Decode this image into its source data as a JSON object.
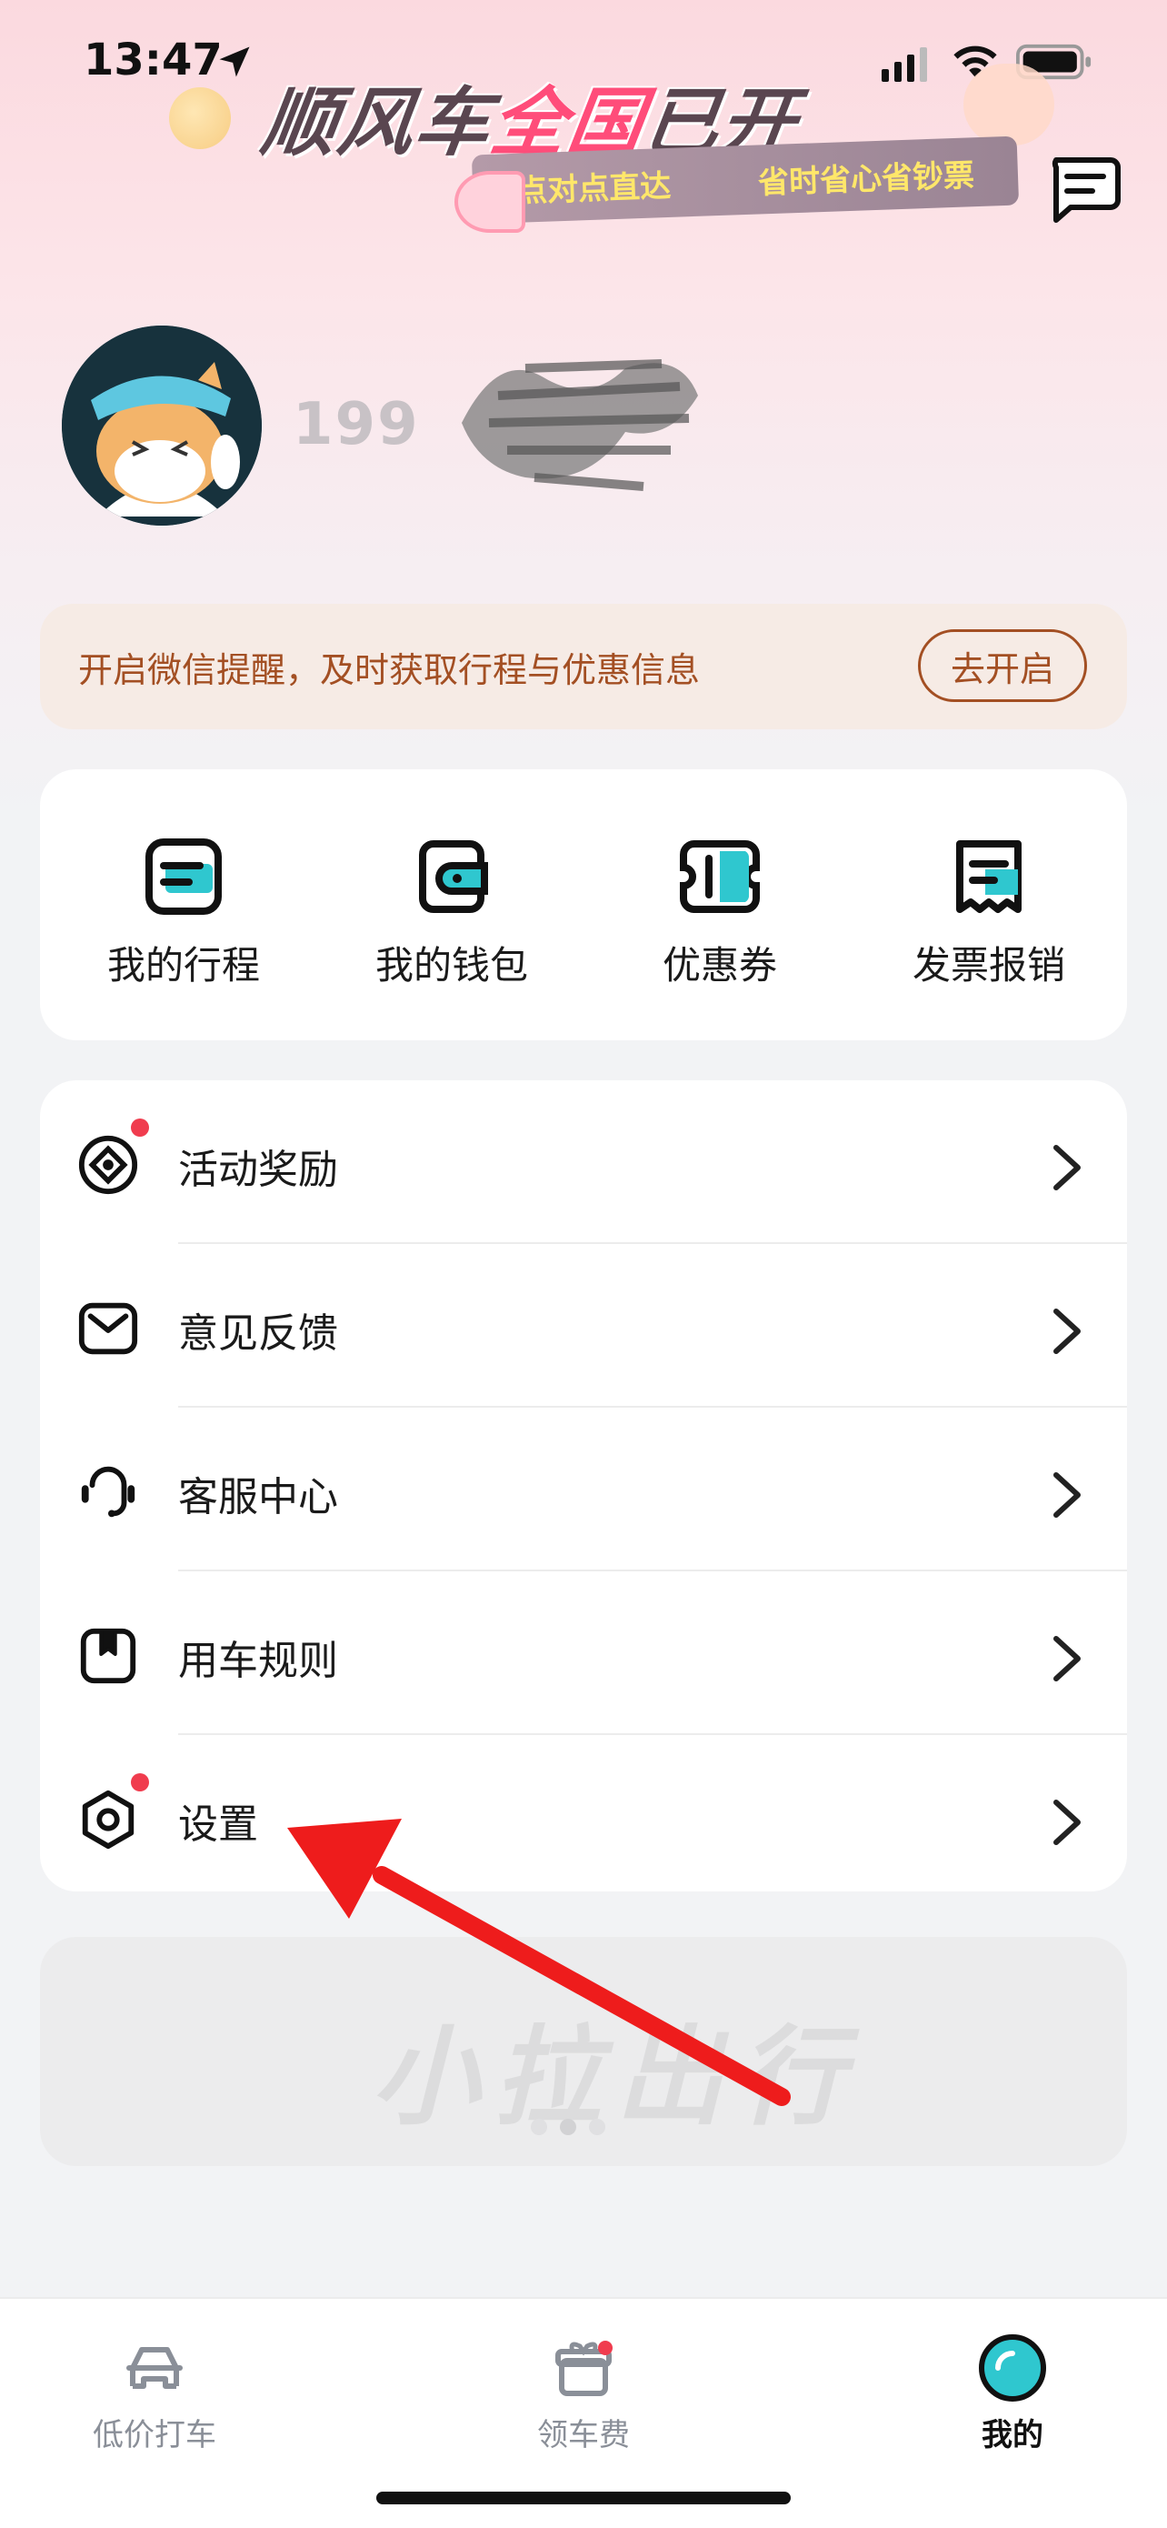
{
  "status_bar": {
    "time": "13:47"
  },
  "banner": {
    "title_prefix": "顺风车",
    "title_highlight": "全国",
    "title_suffix": "已开",
    "ribbon_left": "点对点直达",
    "ribbon_right": "省时省心省钞票"
  },
  "profile": {
    "phone_visible": "199"
  },
  "wechat_notice": {
    "text": "开启微信提醒，及时获取行程与优惠信息",
    "button": "去开启"
  },
  "quick_actions": [
    {
      "label": "我的行程",
      "icon": "trip-icon"
    },
    {
      "label": "我的钱包",
      "icon": "wallet-icon"
    },
    {
      "label": "优惠券",
      "icon": "coupon-icon"
    },
    {
      "label": "发票报销",
      "icon": "invoice-icon"
    }
  ],
  "menu": [
    {
      "label": "活动奖励",
      "icon": "reward-icon",
      "badge": true
    },
    {
      "label": "意见反馈",
      "icon": "envelope-icon",
      "badge": false
    },
    {
      "label": "客服中心",
      "icon": "headset-icon",
      "badge": false
    },
    {
      "label": "用车规则",
      "icon": "rules-book-icon",
      "badge": false
    },
    {
      "label": "设置",
      "icon": "settings-hexagon-icon",
      "badge": true
    }
  ],
  "watermark_banner": {
    "text": "小拉出行"
  },
  "tab_bar": [
    {
      "label": "低价打车",
      "active": false
    },
    {
      "label": "领车费",
      "active": false
    },
    {
      "label": "我的",
      "active": true
    }
  ],
  "colors": {
    "accent_teal": "#2fc7cf",
    "notice_text": "#a34f23",
    "badge_red": "#f03c4e",
    "annotation_arrow": "#ee1c1c"
  }
}
